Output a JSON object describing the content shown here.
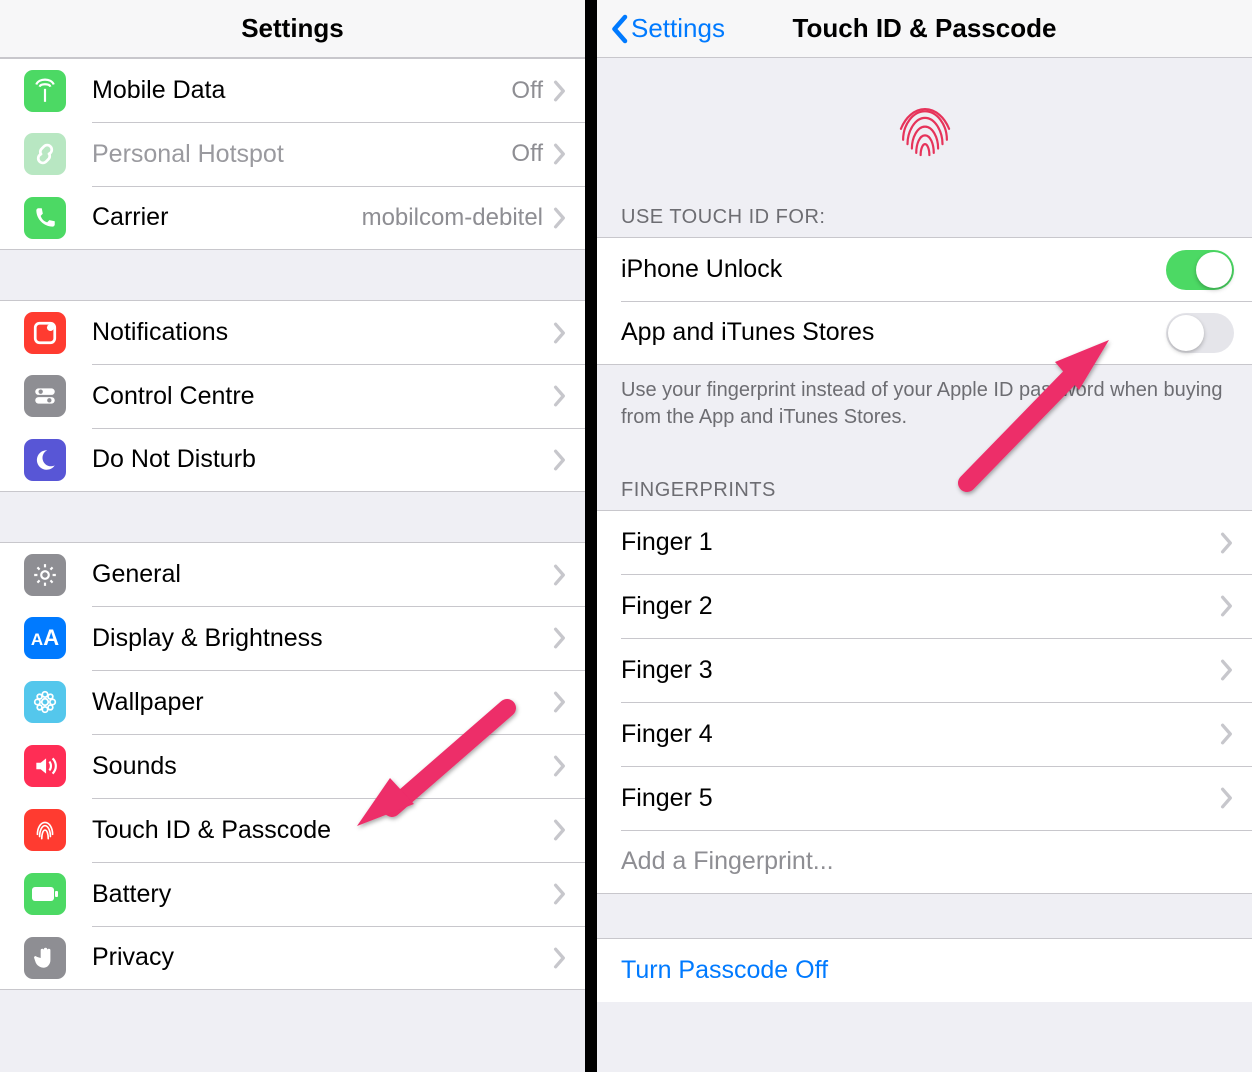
{
  "left": {
    "title": "Settings",
    "groups": [
      {
        "type": "cells",
        "items": [
          {
            "id": "mobile-data",
            "label": "Mobile Data",
            "value": "Off",
            "disclosure": true,
            "icon": {
              "bg": "#4cd964",
              "glyph": "antenna"
            }
          },
          {
            "id": "personal-hotspot",
            "label": "Personal Hotspot",
            "value": "Off",
            "disclosure": true,
            "disabled": true,
            "icon": {
              "bg": "#b8e7c2",
              "glyph": "chain"
            }
          },
          {
            "id": "carrier",
            "label": "Carrier",
            "value": "mobilcom-debitel",
            "disclosure": true,
            "icon": {
              "bg": "#4cd964",
              "glyph": "phone"
            }
          }
        ]
      },
      {
        "type": "cells",
        "items": [
          {
            "id": "notifications",
            "label": "Notifications",
            "disclosure": true,
            "icon": {
              "bg": "#ff3b30",
              "glyph": "notif"
            }
          },
          {
            "id": "control-centre",
            "label": "Control Centre",
            "disclosure": true,
            "icon": {
              "bg": "#8e8e93",
              "glyph": "switches"
            }
          },
          {
            "id": "do-not-disturb",
            "label": "Do Not Disturb",
            "disclosure": true,
            "icon": {
              "bg": "#5856d6",
              "glyph": "moon"
            }
          }
        ]
      },
      {
        "type": "cells",
        "items": [
          {
            "id": "general",
            "label": "General",
            "disclosure": true,
            "icon": {
              "bg": "#8e8e93",
              "glyph": "gear"
            }
          },
          {
            "id": "display",
            "label": "Display & Brightness",
            "disclosure": true,
            "icon": {
              "bg": "#007aff",
              "glyph": "aa"
            }
          },
          {
            "id": "wallpaper",
            "label": "Wallpaper",
            "disclosure": true,
            "icon": {
              "bg": "#54c7ec",
              "glyph": "flower"
            }
          },
          {
            "id": "sounds",
            "label": "Sounds",
            "disclosure": true,
            "icon": {
              "bg": "#ff2d55",
              "glyph": "speaker"
            }
          },
          {
            "id": "touchid",
            "label": "Touch ID & Passcode",
            "disclosure": true,
            "icon": {
              "bg": "#ff3b30",
              "glyph": "fingerprint"
            }
          },
          {
            "id": "battery",
            "label": "Battery",
            "disclosure": true,
            "icon": {
              "bg": "#4cd964",
              "glyph": "battery"
            }
          },
          {
            "id": "privacy",
            "label": "Privacy",
            "disclosure": true,
            "icon": {
              "bg": "#8e8e93",
              "glyph": "hand"
            }
          }
        ]
      }
    ]
  },
  "right": {
    "back_label": "Settings",
    "title": "Touch ID & Passcode",
    "use_label": "USE TOUCH ID FOR:",
    "use_items": [
      {
        "id": "iphone-unlock",
        "label": "iPhone Unlock",
        "on": true
      },
      {
        "id": "app-itunes",
        "label": "App and iTunes Stores",
        "on": false
      }
    ],
    "use_footer": "Use your fingerprint instead of your Apple ID password when buying from the App and iTunes Stores.",
    "fingerprints_label": "FINGERPRINTS",
    "fingerprints": [
      {
        "id": "finger-1",
        "label": "Finger 1"
      },
      {
        "id": "finger-2",
        "label": "Finger 2"
      },
      {
        "id": "finger-3",
        "label": "Finger 3"
      },
      {
        "id": "finger-4",
        "label": "Finger 4"
      },
      {
        "id": "finger-5",
        "label": "Finger 5"
      }
    ],
    "add_label": "Add a Fingerprint...",
    "passcode_off_label": "Turn Passcode Off"
  }
}
